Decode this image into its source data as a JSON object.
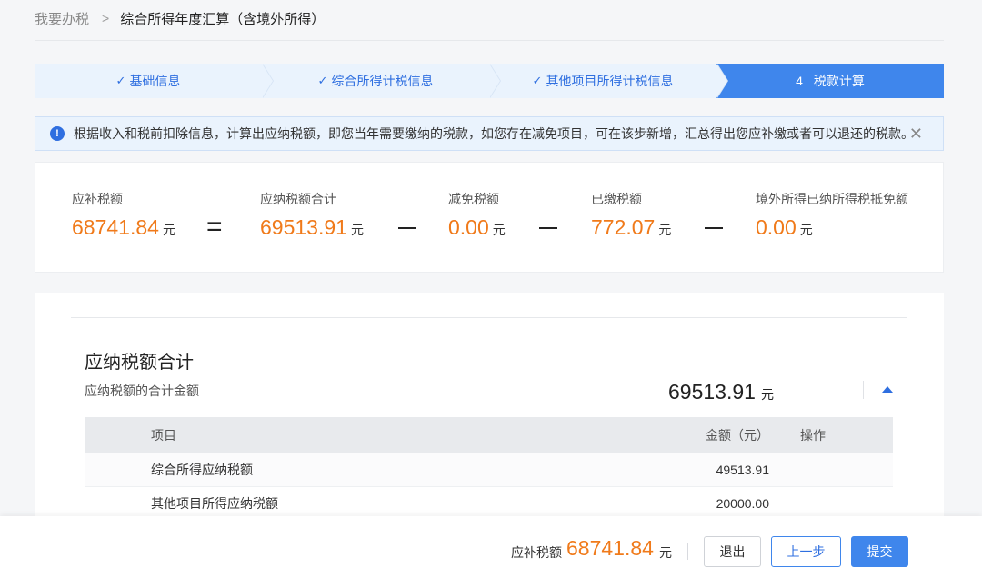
{
  "breadcrumb": {
    "home": "我要办税",
    "separator": ">",
    "current": "综合所得年度汇算（含境外所得）"
  },
  "steps": [
    {
      "check": "✓",
      "label": "基础信息"
    },
    {
      "check": "✓",
      "label": "综合所得计税信息"
    },
    {
      "check": "✓",
      "label": "其他项目所得计税信息"
    },
    {
      "num": "4",
      "label": "税款计算"
    }
  ],
  "notice": {
    "icon": "!",
    "text": "根据收入和税前扣除信息，计算出应纳税额，即您当年需要缴纳的税款，如您存在减免项目，可在该步新增，汇总得出您应补缴或者可以退还的税款。",
    "close": "✕"
  },
  "formula": {
    "unit": "元",
    "payable": {
      "label": "应补税额",
      "value": "68741.84"
    },
    "eq": "=",
    "total": {
      "label": "应纳税额合计",
      "value": "69513.91"
    },
    "reduction": {
      "label": "减免税额",
      "value": "0.00"
    },
    "paid": {
      "label": "已缴税额",
      "value": "772.07"
    },
    "foreign_credit": {
      "label": "境外所得已纳所得税抵免额",
      "value": "0.00"
    }
  },
  "section": {
    "title": "应纳税额合计",
    "subtitle": "应纳税额的合计金额",
    "amount": "69513.91",
    "unit": "元"
  },
  "table": {
    "headers": {
      "item": "项目",
      "amount": "金额（元）",
      "action": "操作"
    },
    "rows": [
      {
        "item": "综合所得应纳税额",
        "amount": "49513.91"
      },
      {
        "item": "其他项目所得应纳税额",
        "amount": "20000.00"
      }
    ]
  },
  "footer": {
    "label": "应补税额",
    "value": "68741.84",
    "unit": "元",
    "exit_label": "退出",
    "prev_label": "上一步",
    "submit_label": "提交"
  }
}
